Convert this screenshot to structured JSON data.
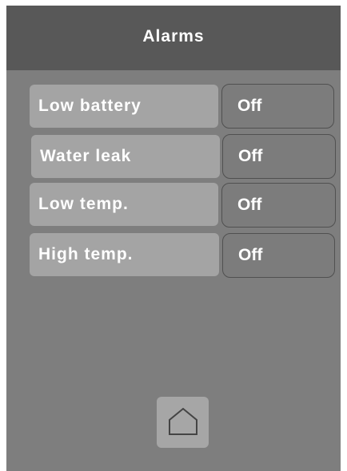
{
  "header": {
    "title": "Alarms"
  },
  "alarms": [
    {
      "label": "Low battery",
      "value": "Off"
    },
    {
      "label": "Water leak",
      "value": "Off"
    },
    {
      "label": "Low temp.",
      "value": "Off"
    },
    {
      "label": "High temp.",
      "value": "Off"
    }
  ],
  "footer": {
    "home_icon": "home-icon"
  },
  "colors": {
    "header_bg": "#585858",
    "screen_bg": "#7e7e7e",
    "label_bg": "#a4a4a4",
    "value_border": "#505050"
  }
}
